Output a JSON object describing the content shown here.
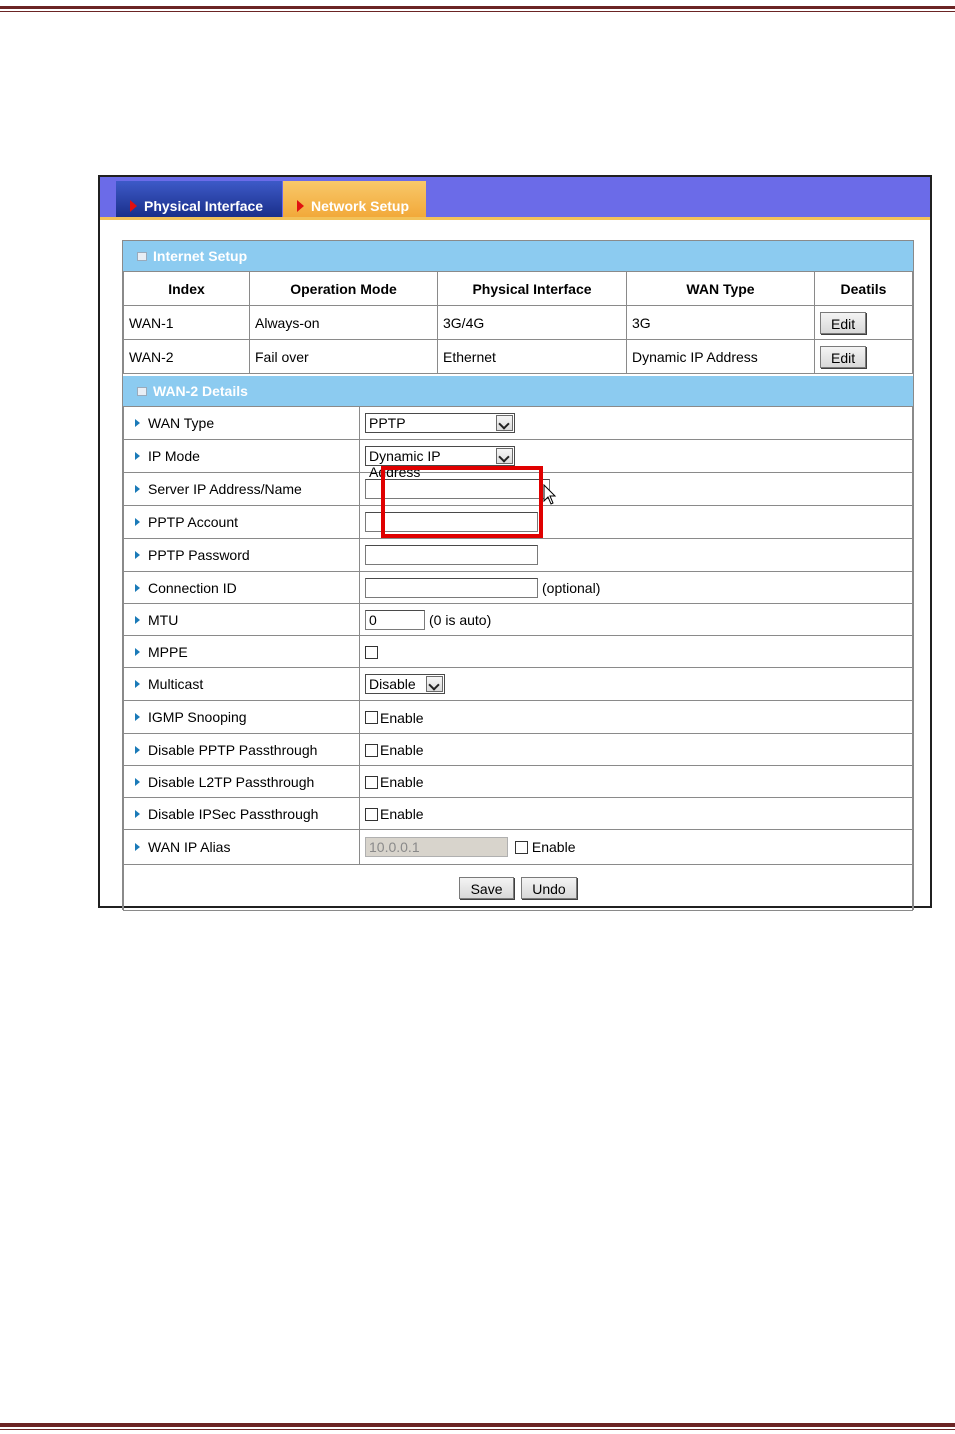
{
  "tabs": [
    {
      "label": "Physical Interface"
    },
    {
      "label": "Network Setup"
    }
  ],
  "internet_setup": {
    "title": "Internet Setup",
    "columns": [
      "Index",
      "Operation Mode",
      "Physical Interface",
      "WAN Type",
      "Deatils"
    ],
    "rows": [
      {
        "index": "WAN-1",
        "mode": "Always-on",
        "iface": "3G/4G",
        "wan_type": "3G",
        "action": "Edit"
      },
      {
        "index": "WAN-2",
        "mode": "Fail over",
        "iface": "Ethernet",
        "wan_type": "Dynamic IP Address",
        "action": "Edit"
      }
    ]
  },
  "details": {
    "title": "WAN-2 Details",
    "wan_type": {
      "label": "WAN Type",
      "value": "PPTP"
    },
    "ip_mode": {
      "label": "IP Mode",
      "value": "Dynamic IP Address"
    },
    "server_ip": {
      "label": "Server IP Address/Name",
      "value": ""
    },
    "pptp_account": {
      "label": "PPTP Account",
      "value": ""
    },
    "pptp_password": {
      "label": "PPTP Password",
      "value": ""
    },
    "connection_id": {
      "label": "Connection ID",
      "value": "",
      "hint": "(optional)"
    },
    "mtu": {
      "label": "MTU",
      "value": "0",
      "hint": "(0 is auto)"
    },
    "mppe": {
      "label": "MPPE",
      "checked": false
    },
    "multicast": {
      "label": "Multicast",
      "value": "Disable"
    },
    "igmp": {
      "label": "IGMP Snooping",
      "option": "Enable",
      "checked": false
    },
    "pptp_pass": {
      "label": "Disable PPTP Passthrough",
      "option": "Enable",
      "checked": false
    },
    "l2tp_pass": {
      "label": "Disable L2TP Passthrough",
      "option": "Enable",
      "checked": false
    },
    "ipsec_pass": {
      "label": "Disable IPSec Passthrough",
      "option": "Enable",
      "checked": false
    },
    "ip_alias": {
      "label": "WAN IP Alias",
      "value": "10.0.0.1",
      "option": "Enable",
      "checked": false
    }
  },
  "actions": {
    "save": "Save",
    "undo": "Undo"
  },
  "colors": {
    "tab_bar": "#6b6be8",
    "section_header": "#8ccbf0",
    "highlight": "#e00000",
    "rule": "#6b2424"
  }
}
